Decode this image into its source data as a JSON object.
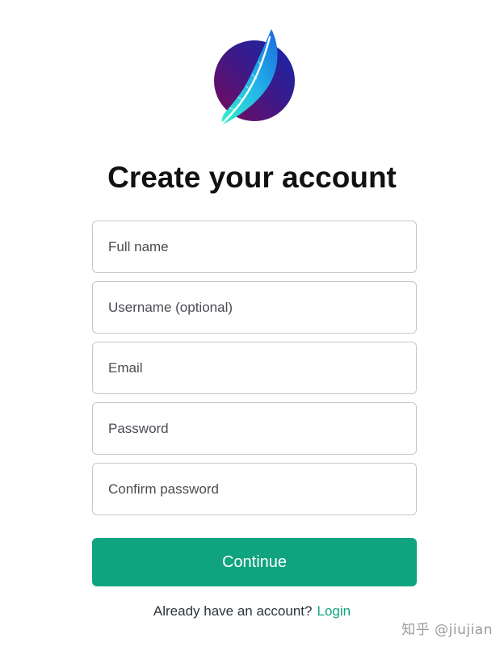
{
  "brand": {
    "logo_icon": "feather-logo-icon",
    "colors": {
      "circle_dark": "#5a1a7a",
      "circle_blue": "#1a2a9a",
      "feather_cyan": "#2de0d0",
      "feather_blue": "#1a8ae6"
    }
  },
  "page": {
    "title": "Create your account"
  },
  "form": {
    "fields": [
      {
        "placeholder": "Full name",
        "value": ""
      },
      {
        "placeholder": "Username (optional)",
        "value": ""
      },
      {
        "placeholder": "Email",
        "value": ""
      },
      {
        "placeholder": "Password",
        "value": ""
      },
      {
        "placeholder": "Confirm password",
        "value": ""
      }
    ],
    "submit_label": "Continue",
    "accent_color": "#10a37f"
  },
  "footer": {
    "prompt": "Already have an account?",
    "login_label": "Login"
  },
  "watermark": {
    "text": "知乎 @jiujian"
  }
}
